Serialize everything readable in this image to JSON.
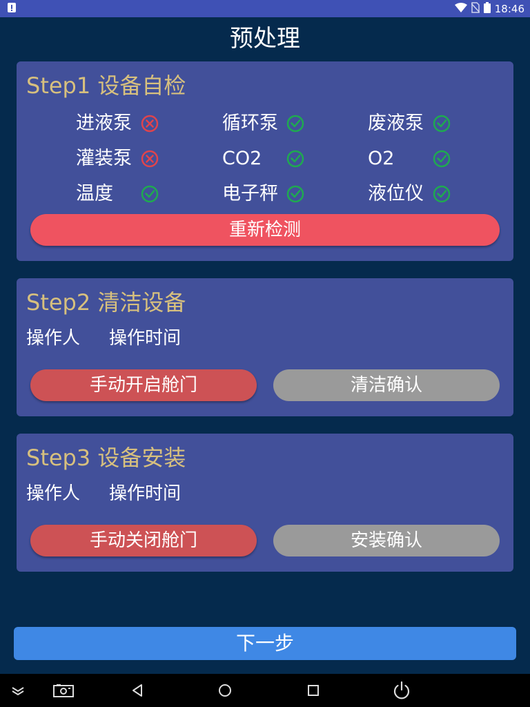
{
  "status_bar": {
    "time": "18:46",
    "icons": [
      "notification-icon",
      "wifi-icon",
      "no-sim-icon",
      "battery-icon"
    ]
  },
  "page": {
    "title": "预处理"
  },
  "step1": {
    "heading": "Step1 设备自检",
    "items": [
      {
        "label": "进液泵",
        "status": "error"
      },
      {
        "label": "循环泵",
        "status": "ok"
      },
      {
        "label": "废液泵",
        "status": "ok"
      },
      {
        "label": "灌装泵",
        "status": "error"
      },
      {
        "label": "CO2",
        "status": "ok"
      },
      {
        "label": "O2",
        "status": "ok"
      },
      {
        "label": "温度",
        "status": "ok"
      },
      {
        "label": "电子秤",
        "status": "ok"
      },
      {
        "label": "液位仪",
        "status": "ok"
      }
    ],
    "recheck_label": "重新检测"
  },
  "step2": {
    "heading": "Step2 清洁设备",
    "operator_label": "操作人",
    "time_label": "操作时间",
    "open_door_label": "手动开启舱门",
    "confirm_label": "清洁确认"
  },
  "step3": {
    "heading": "Step3 设备安装",
    "operator_label": "操作人",
    "time_label": "操作时间",
    "close_door_label": "手动关闭舱门",
    "confirm_label": "安装确认"
  },
  "next_label": "下一步",
  "colors": {
    "background": "#052a4d",
    "card": "#42509a",
    "heading": "#d7c07e",
    "error": "#e0444c",
    "ok": "#1faa50",
    "recheck": "#ef5360",
    "door_button": "#cd5255",
    "confirm_button": "#9a9a9a",
    "next_button": "#3f88e5",
    "status_bar": "#3f51b5"
  }
}
